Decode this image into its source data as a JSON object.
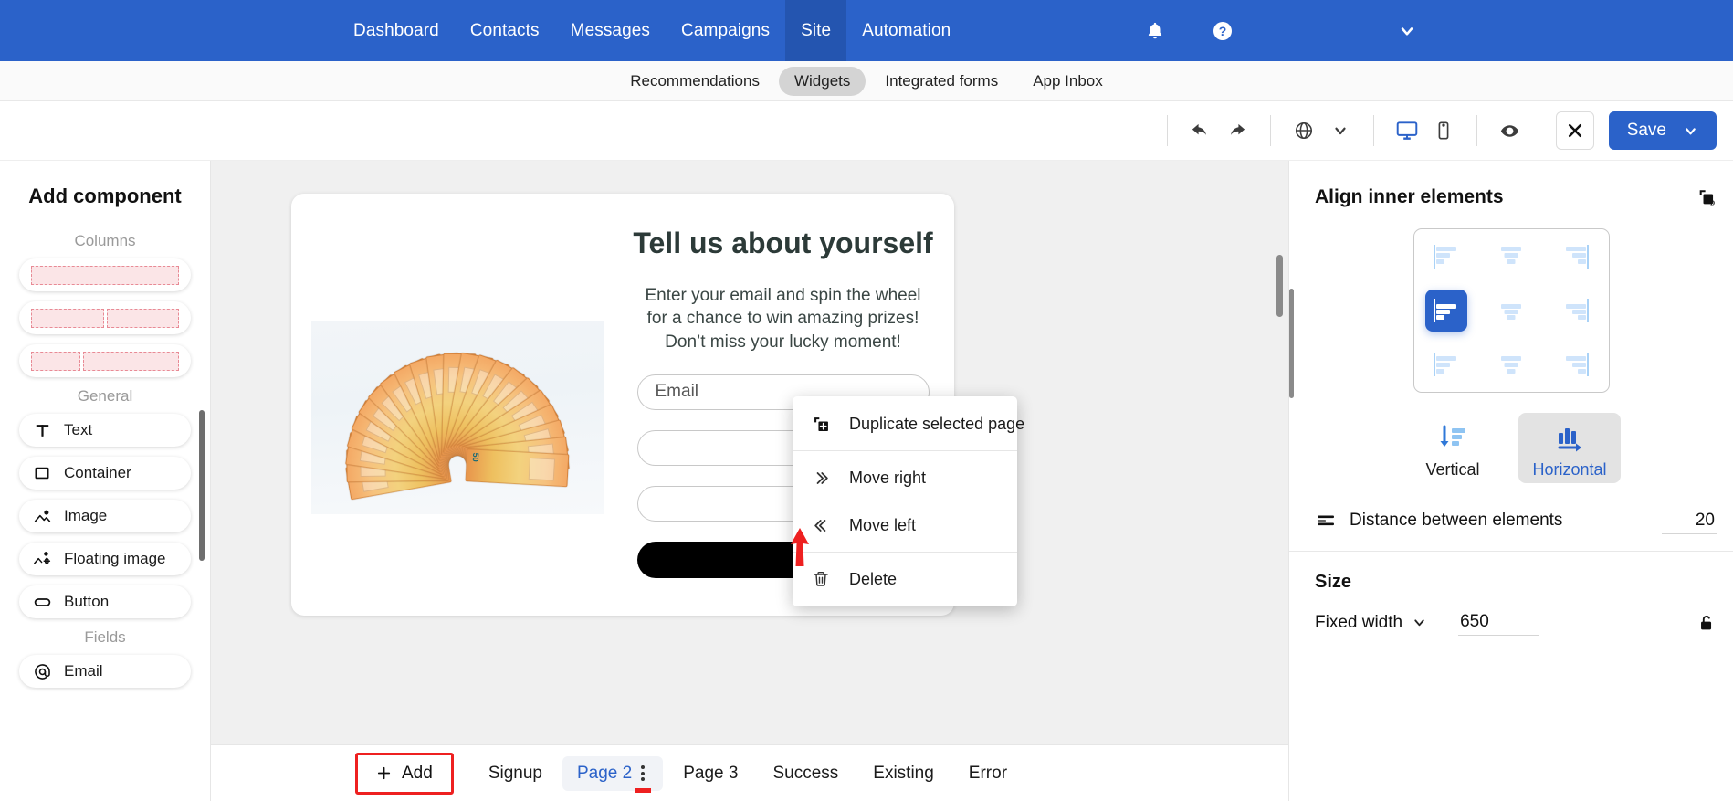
{
  "topnav": {
    "links": [
      {
        "label": "Dashboard",
        "active": false
      },
      {
        "label": "Contacts",
        "active": false
      },
      {
        "label": "Messages",
        "active": false
      },
      {
        "label": "Campaigns",
        "active": false
      },
      {
        "label": "Site",
        "active": true
      },
      {
        "label": "Automation",
        "active": false
      }
    ],
    "icons": [
      "bell-icon",
      "help-circle-icon",
      "chevron-down-icon"
    ],
    "brand_color": "#2b62c9",
    "active_color": "#2455b0"
  },
  "subnav": {
    "items": [
      {
        "label": "Recommendations",
        "active": false
      },
      {
        "label": "Widgets",
        "active": true
      },
      {
        "label": "Integrated forms",
        "active": false
      },
      {
        "label": "App Inbox",
        "active": false
      }
    ]
  },
  "toolbar": {
    "undo": "undo-icon",
    "redo": "redo-icon",
    "language": "globe-icon",
    "language_chevron": "chevron-down-icon",
    "desktop": "desktop-icon",
    "mobile": "mobile-icon",
    "preview": "eye-icon",
    "close": "close-icon",
    "save_label": "Save",
    "save_chevron": "chevron-down-icon"
  },
  "sidebar": {
    "title": "Add component",
    "groups": [
      {
        "label": "Columns",
        "kind": "columns",
        "cards": [
          {
            "segments": [
              1
            ]
          },
          {
            "segments": [
              1,
              1
            ]
          },
          {
            "segments": [
              1,
              2
            ]
          }
        ]
      },
      {
        "label": "General",
        "kind": "items",
        "items": [
          {
            "label": "Text",
            "icon": "text-icon"
          },
          {
            "label": "Container",
            "icon": "container-icon"
          },
          {
            "label": "Image",
            "icon": "image-icon"
          },
          {
            "label": "Floating image",
            "icon": "floating-image-icon"
          },
          {
            "label": "Button",
            "icon": "button-icon"
          }
        ]
      },
      {
        "label": "Fields",
        "kind": "items",
        "items": [
          {
            "label": "Email",
            "icon": "at-icon"
          }
        ]
      }
    ]
  },
  "canvas": {
    "widget": {
      "heading": "Tell us about yourself",
      "subtext": "Enter your email and spin the wheel for a chance to win amazing prizes! Don’t miss your lucky moment!",
      "image_alt": "euro-banknotes-fan-image",
      "fields": [
        {
          "placeholder": "Email",
          "value": "Email"
        },
        {
          "placeholder": "",
          "value": ""
        },
        {
          "placeholder": "",
          "value": ""
        }
      ],
      "submit_button_label": ""
    }
  },
  "context_menu": {
    "items": [
      {
        "label": "Duplicate selected page",
        "icon": "duplicate-icon"
      },
      {
        "label": "Move right",
        "icon": "chevrons-right-icon"
      },
      {
        "label": "Move left",
        "icon": "chevrons-left-icon"
      },
      {
        "label": "Delete",
        "icon": "trash-icon"
      }
    ]
  },
  "annotation": {
    "arrow_color": "#ee2020",
    "highlight_color": "#ee2020"
  },
  "rightpanel": {
    "title": "Align inner elements",
    "copy_style_icon": "copy-style-icon",
    "align_options": [
      "top-left",
      "top-center",
      "top-right",
      "middle-left",
      "middle-center",
      "middle-right",
      "bottom-left",
      "bottom-center",
      "bottom-right"
    ],
    "align_selected": "middle-left",
    "orientation": [
      {
        "label": "Vertical",
        "icon": "vertical-stack-icon",
        "active": false
      },
      {
        "label": "Horizontal",
        "icon": "horizontal-stack-icon",
        "active": true
      }
    ],
    "distance": {
      "icon": "distance-icon",
      "label": "Distance between elements",
      "value": "20"
    },
    "size": {
      "title": "Size",
      "mode_label": "Fixed width",
      "mode_chevron": "chevron-down-icon",
      "value": "650",
      "lock_icon": "lock-open-icon"
    }
  },
  "pagebar": {
    "add_label": "Add",
    "add_icon": "plus-icon",
    "tabs": [
      {
        "label": "Signup",
        "active": false,
        "menu": false
      },
      {
        "label": "Page 2",
        "active": true,
        "menu": true
      },
      {
        "label": "Page 3",
        "active": false,
        "menu": false
      },
      {
        "label": "Success",
        "active": false,
        "menu": false
      },
      {
        "label": "Existing",
        "active": false,
        "menu": false
      },
      {
        "label": "Error",
        "active": false,
        "menu": false
      }
    ],
    "kebab_icon": "kebab-menu-icon"
  }
}
